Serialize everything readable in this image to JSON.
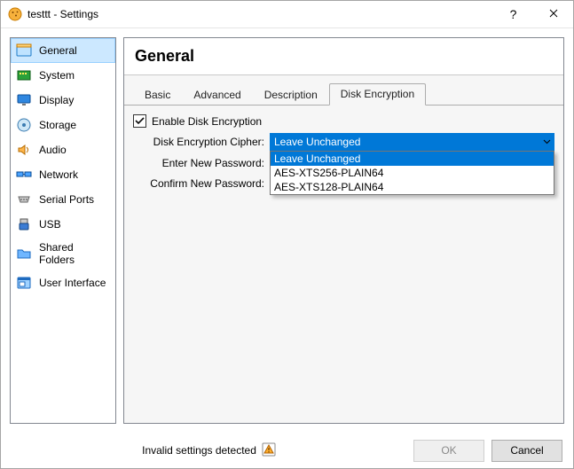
{
  "window": {
    "title": "testtt - Settings"
  },
  "sidebar": {
    "items": [
      {
        "label": "General"
      },
      {
        "label": "System"
      },
      {
        "label": "Display"
      },
      {
        "label": "Storage"
      },
      {
        "label": "Audio"
      },
      {
        "label": "Network"
      },
      {
        "label": "Serial Ports"
      },
      {
        "label": "USB"
      },
      {
        "label": "Shared Folders"
      },
      {
        "label": "User Interface"
      }
    ]
  },
  "main": {
    "heading": "General",
    "tabs": [
      {
        "label": "Basic"
      },
      {
        "label": "Advanced"
      },
      {
        "label": "Description"
      },
      {
        "label": "Disk Encryption"
      }
    ],
    "encryption": {
      "enable_label": "Enable Disk Encryption",
      "enable_checked": true,
      "cipher_label": "Disk Encryption Cipher:",
      "cipher_selected": "Leave Unchanged",
      "cipher_options": [
        "Leave Unchanged",
        "AES-XTS256-PLAIN64",
        "AES-XTS128-PLAIN64"
      ],
      "new_pwd_label": "Enter New Password:",
      "confirm_pwd_label": "Confirm New Password:"
    }
  },
  "footer": {
    "status": "Invalid settings detected",
    "ok": "OK",
    "cancel": "Cancel"
  }
}
